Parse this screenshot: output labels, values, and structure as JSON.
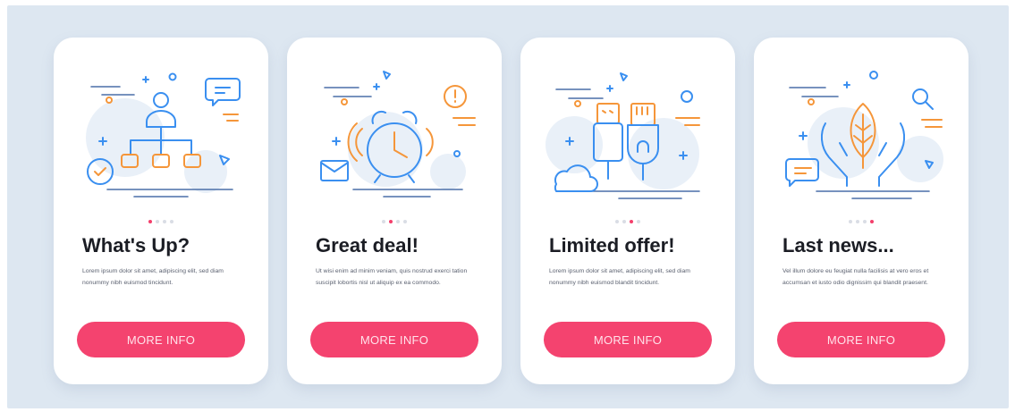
{
  "cards": [
    {
      "icon": "management-org-chart-icon",
      "title": "What's Up?",
      "description": "Lorem ipsum dolor sit amet, adipiscing elit, sed diam nonummy nibh euismod tincidunt.",
      "button_label": "MORE INFO",
      "active_dot": 1
    },
    {
      "icon": "alarm-clock-icon",
      "title": "Great deal!",
      "description": "Ut wisi enim ad minim veniam, quis nostrud exerci tation suscipit lobortis nisl ut aliquip ex ea commodo.",
      "button_label": "MORE INFO",
      "active_dot": 2
    },
    {
      "icon": "usb-cable-connector-icon",
      "title": "Limited offer!",
      "description": "Lorem ipsum dolor sit amet, adipiscing elit, sed diam nonummy nibh euismod blandit tincidunt.",
      "button_label": "MORE INFO",
      "active_dot": 3
    },
    {
      "icon": "eco-leaf-hands-icon",
      "title": "Last news...",
      "description": "Vel illum dolore eu feugiat nulla facilisis at vero eros et accumsan et iusto odio dignissim qui blandit praesent.",
      "button_label": "MORE INFO",
      "active_dot": 4
    }
  ],
  "pagination_total": 4,
  "colors": {
    "accent": "#f4436f",
    "icon_blue": "#3a8ff0",
    "icon_orange": "#f5963a",
    "background": "#dde7f1"
  }
}
